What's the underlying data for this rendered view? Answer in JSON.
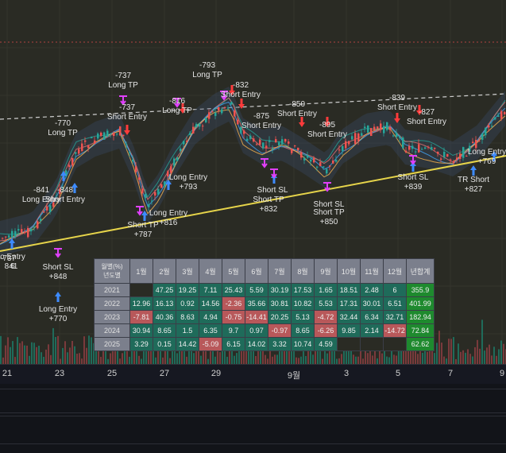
{
  "x_axis": {
    "ticks": [
      "21",
      "23",
      "25",
      "27",
      "29",
      "9월",
      "3",
      "5",
      "7",
      "9"
    ]
  },
  "signals": [
    {
      "text": "-737",
      "text2": "Long TP"
    },
    {
      "text": "-793",
      "text2": "Long TP"
    },
    {
      "text": "-832",
      "text2": "Short Entry"
    },
    {
      "text": "-816",
      "text2": "Long TP"
    },
    {
      "text": "-737",
      "text2": "Short Entry"
    },
    {
      "text": "-770",
      "text2": "Long TP"
    },
    {
      "text": "-850",
      "text2": "Short Entry"
    },
    {
      "text": "-875",
      "text2": "Short Entry"
    },
    {
      "text": "-895",
      "text2": "Short Entry"
    },
    {
      "text": "-839",
      "text2": "Short Entry"
    },
    {
      "text": "-827",
      "text2": "Short Entry"
    },
    {
      "text": "-841",
      "text2": "Long Entry"
    },
    {
      "text": "-848",
      "text2": "Short Entry"
    },
    {
      "text": "-737",
      "text2": ""
    },
    {
      "text": "Long Entry",
      "text2": "+793"
    },
    {
      "text": "Long Entry",
      "text2": "+816"
    },
    {
      "text": "Short TP",
      "text2": "+787"
    },
    {
      "text": "Short SL",
      "text2": ""
    },
    {
      "text": "Short TP",
      "text2": "+832"
    },
    {
      "text": "Short SL",
      "text2": ""
    },
    {
      "text": "Short TP",
      "text2": "+850"
    },
    {
      "text": "Short SL",
      "text2": "+839"
    },
    {
      "text": "TR Short",
      "text2": "+827"
    },
    {
      "text": "Long Entry",
      "text2": "+769"
    },
    {
      "text": "Long Entry",
      "text2": "+770"
    },
    {
      "text": "Short SL",
      "text2": "+848"
    },
    {
      "text": "o Entry",
      "text2": "6"
    },
    {
      "text": "841",
      "text2": ""
    }
  ],
  "perf_table": {
    "corner_top": "월별(%)",
    "corner_bottom": "년도별",
    "months": [
      "1월",
      "2월",
      "3월",
      "4월",
      "5월",
      "6월",
      "7월",
      "8월",
      "9월",
      "10월",
      "11월",
      "12월"
    ],
    "total_label": "년합계",
    "rows": [
      {
        "year": "2021",
        "vals": [
          "",
          "47.25",
          "19.25",
          "7.11",
          "25.43",
          "5.59",
          "30.19",
          "17.53",
          "1.65",
          "18.51",
          "2.48",
          "6"
        ],
        "total": "355.9"
      },
      {
        "year": "2022",
        "vals": [
          "12.96",
          "16.13",
          "0.92",
          "14.56",
          "-2.36",
          "35.66",
          "30.81",
          "10.82",
          "5.53",
          "17.31",
          "30.01",
          "6.51"
        ],
        "total": "401.99"
      },
      {
        "year": "2023",
        "vals": [
          "-7.81",
          "40.36",
          "8.63",
          "4.94",
          "-0.75",
          "-14.41",
          "20.25",
          "5.13",
          "-4.72",
          "32.44",
          "6.34",
          "32.71"
        ],
        "total": "182.94"
      },
      {
        "year": "2024",
        "vals": [
          "30.94",
          "8.65",
          "1.5",
          "6.35",
          "9.7",
          "0.97",
          "-0.97",
          "8.65",
          "-6.26",
          "9.85",
          "2.14",
          "-14.72"
        ],
        "total": "72.84"
      },
      {
        "year": "2025",
        "vals": [
          "3.29",
          "0.15",
          "14.42",
          "-5.09",
          "6.15",
          "14.02",
          "3.32",
          "10.74",
          "4.59",
          "",
          "",
          ""
        ],
        "total": "62.62"
      }
    ]
  },
  "colors": {
    "up": "#26a69a",
    "down": "#ef5350",
    "trendline": "#e6d44a",
    "long_arrow": "#3d8bff",
    "short_arrow": "#ff3b3b",
    "magenta": "#e040fb"
  }
}
